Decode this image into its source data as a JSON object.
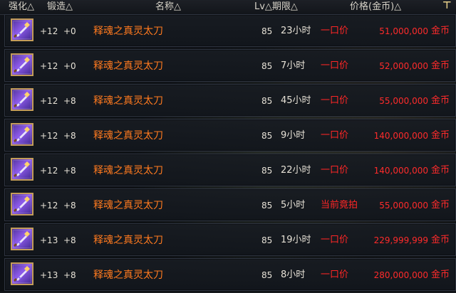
{
  "header": {
    "enhance": "强化△",
    "forge": "锻造△",
    "name": "名称△",
    "level_period": "Lv△期限△",
    "price": "价格(金币)△"
  },
  "rows": [
    {
      "icon": "sword-icon",
      "enhance": "+12",
      "forge": "+0",
      "name": "释魂之真灵太刀",
      "level": "85",
      "period": "23小时",
      "buy_type": "一口价",
      "price": "51,000,000",
      "currency": "金币"
    },
    {
      "icon": "sword-icon",
      "enhance": "+12",
      "forge": "+0",
      "name": "释魂之真灵太刀",
      "level": "85",
      "period": "7小时",
      "buy_type": "一口价",
      "price": "52,000,000",
      "currency": "金币"
    },
    {
      "icon": "sword-icon",
      "enhance": "+12",
      "forge": "+8",
      "name": "释魂之真灵太刀",
      "level": "85",
      "period": "45小时",
      "buy_type": "一口价",
      "price": "55,000,000",
      "currency": "金币"
    },
    {
      "icon": "sword-icon",
      "enhance": "+12",
      "forge": "+8",
      "name": "释魂之真灵太刀",
      "level": "85",
      "period": "9小时",
      "buy_type": "一口价",
      "price": "140,000,000",
      "currency": "金币"
    },
    {
      "icon": "sword-icon",
      "enhance": "+12",
      "forge": "+8",
      "name": "释魂之真灵太刀",
      "level": "85",
      "period": "22小时",
      "buy_type": "一口价",
      "price": "140,000,000",
      "currency": "金币"
    },
    {
      "icon": "sword-icon",
      "enhance": "+12",
      "forge": "+8",
      "name": "释魂之真灵太刀",
      "level": "85",
      "period": "5小时",
      "buy_type": "当前竟拍",
      "price": "55,000,000",
      "currency": "金币"
    },
    {
      "icon": "sword-icon",
      "enhance": "+13",
      "forge": "+8",
      "name": "释魂之真灵太刀",
      "level": "85",
      "period": "19小时",
      "buy_type": "一口价",
      "price": "229,999,999",
      "currency": "金币"
    },
    {
      "icon": "sword-icon",
      "enhance": "+13",
      "forge": "+8",
      "name": "释魂之真灵太刀",
      "level": "85",
      "period": "8小时",
      "buy_type": "一口价",
      "price": "280,000,000",
      "currency": "金币"
    }
  ]
}
